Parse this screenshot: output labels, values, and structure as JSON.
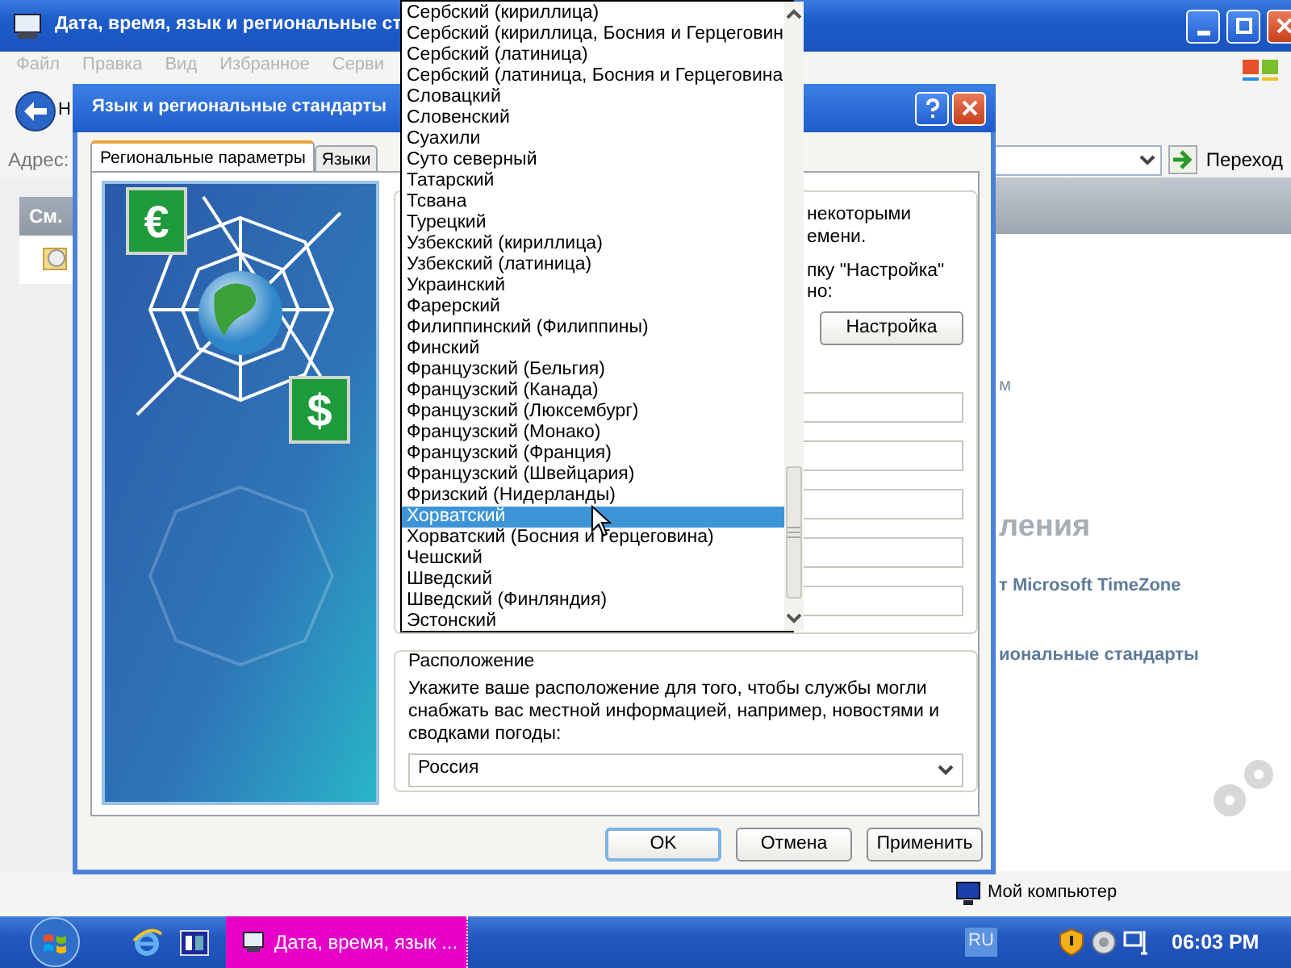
{
  "explorer": {
    "title": "Дата, время, язык и региональные ст",
    "menu": [
      "Файл",
      "Правка",
      "Вид",
      "Избранное",
      "Серви"
    ],
    "back_label": "Н",
    "address_label": "Адрес:",
    "go_button": "Переход",
    "side_header": "См.",
    "content_fragments": [
      {
        "kind": "small",
        "text": "м"
      },
      {
        "kind": "heading",
        "text": "ления"
      },
      {
        "kind": "link",
        "text": "т Microsoft TimeZone"
      },
      {
        "kind": "link",
        "text": "иональные стандарты"
      }
    ],
    "status_bar": "Мой компьютер"
  },
  "dialog": {
    "title": "Язык и региональные стандарты",
    "illustration_badges": [
      "€",
      "$"
    ],
    "tabs": [
      {
        "label": "Региональные параметры",
        "selected": true
      },
      {
        "label": "Языки",
        "selected": false
      }
    ],
    "format_group": {
      "fragments": [
        "некоторыми",
        "емени.",
        "пку \"Настройка\"",
        "но:"
      ],
      "customize_button": "Настройка"
    },
    "location_group": {
      "legend": "Расположение",
      "text": "Укажите ваше расположение для того, чтобы службы могли снабжать вас местной информацией, например, новостями и сводками погоды:",
      "value": "Россия"
    },
    "buttons": [
      {
        "label": "OK",
        "default": true
      },
      {
        "label": "Отмена",
        "default": false
      },
      {
        "label": "Применить",
        "default": false
      }
    ]
  },
  "dropdown": {
    "items": [
      {
        "label": "Сербский (кириллица)",
        "selected": false
      },
      {
        "label": "Сербский (кириллица, Босния и Герцеговин",
        "selected": false
      },
      {
        "label": "Сербский (латиница)",
        "selected": false
      },
      {
        "label": "Сербский (латиница, Босния и Герцеговина",
        "selected": false
      },
      {
        "label": "Словацкий",
        "selected": false
      },
      {
        "label": "Словенский",
        "selected": false
      },
      {
        "label": "Суахили",
        "selected": false
      },
      {
        "label": "Суто северный",
        "selected": false
      },
      {
        "label": "Татарский",
        "selected": false
      },
      {
        "label": "Тсвана",
        "selected": false
      },
      {
        "label": "Турецкий",
        "selected": false
      },
      {
        "label": "Узбекский (кириллица)",
        "selected": false
      },
      {
        "label": "Узбекский (латиница)",
        "selected": false
      },
      {
        "label": "Украинский",
        "selected": false
      },
      {
        "label": "Фарерский",
        "selected": false
      },
      {
        "label": "Филиппинский (Филиппины)",
        "selected": false
      },
      {
        "label": "Финский",
        "selected": false
      },
      {
        "label": "Французский (Бельгия)",
        "selected": false
      },
      {
        "label": "Французский (Канада)",
        "selected": false
      },
      {
        "label": "Французский (Люксембург)",
        "selected": false
      },
      {
        "label": "Французский (Монако)",
        "selected": false
      },
      {
        "label": "Французский (Франция)",
        "selected": false
      },
      {
        "label": "Французский (Швейцария)",
        "selected": false
      },
      {
        "label": "Фризский (Нидерланды)",
        "selected": false
      },
      {
        "label": "Хорватский",
        "selected": true
      },
      {
        "label": "Хорватский (Босния и Герцеговина)",
        "selected": false
      },
      {
        "label": "Чешский",
        "selected": false
      },
      {
        "label": "Шведский",
        "selected": false
      },
      {
        "label": "Шведский (Финляндия)",
        "selected": false
      },
      {
        "label": "Эстонский",
        "selected": false
      }
    ]
  },
  "taskbar": {
    "tasks": [
      {
        "label": "Дата, время, язык ...",
        "active": true
      }
    ],
    "language": "RU",
    "clock": "06:03 PM"
  }
}
